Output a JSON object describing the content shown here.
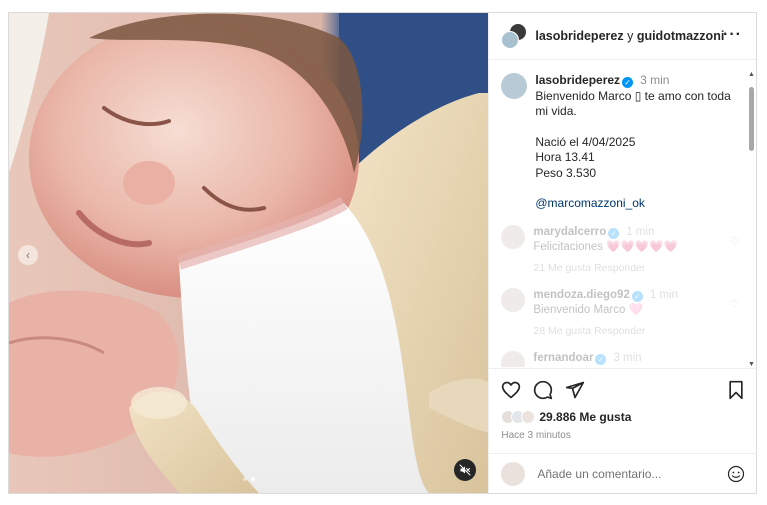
{
  "header": {
    "user1": "lasobrideperez",
    "conjunction": "y",
    "user2": "guidotmazzoni",
    "more_icon": "more-horizontal-icon"
  },
  "caption": {
    "username": "lasobrideperez",
    "time": "3 min",
    "line1": "Bienvenido Marco ▯ te amo con toda",
    "line2": "mi vida.",
    "line3": "Nació el 4/04/2025",
    "line4": "Hora 13.41",
    "line5": "Peso 3.530",
    "mention": "@marcomazzoni_ok"
  },
  "comments": [
    {
      "username": "marydalcerro",
      "time": "1 min",
      "text": "Felicitaciones 💗💗💗💗💗",
      "meta": "21 Me gusta   Responder"
    },
    {
      "username": "mendoza.diego92",
      "time": "1 min",
      "text": "Bienvenido Marco 🩷",
      "meta": "28 Me gusta   Responder"
    },
    {
      "username": "fernandoar",
      "time": "3 min",
      "text": "",
      "meta": ""
    }
  ],
  "actions": {
    "likes": "29.886 Me gusta",
    "posted": "Hace 3 minutos"
  },
  "add_comment": {
    "placeholder": "Añade un comentario..."
  },
  "carousel": {
    "total_slides": 2,
    "active_slide": 2
  },
  "colors": {
    "verified": "#0095f6",
    "mention": "#00376b",
    "secondary_text": "#8e8e8e"
  }
}
